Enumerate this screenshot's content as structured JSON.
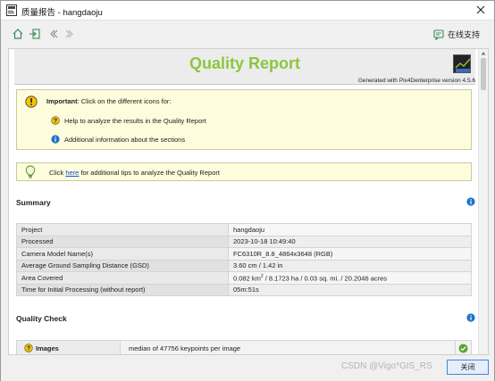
{
  "window": {
    "title": "质量报告 - hangdaoju"
  },
  "toolbar": {
    "support_label": "在线支持"
  },
  "report": {
    "title": "Quality Report",
    "generated_by": "Generated with Pix4Denterprise version 4.5.6",
    "logo_text": "Pix4D"
  },
  "important_box": {
    "important_label": "Important",
    "important_text": ": Click on the different icons for:",
    "help_text": "Help to analyze the results in the Quality Report",
    "info_text": "Additional information about the sections"
  },
  "tips_box": {
    "prefix": "Click ",
    "link_text": "here",
    "suffix": " for additional tips to analyze the Quality Report"
  },
  "summary": {
    "title": "Summary",
    "rows": [
      {
        "label": "Project",
        "value": "hangdaoju"
      },
      {
        "label": "Processed",
        "value": "2023-10-18 10:49:40"
      },
      {
        "label": "Camera Model Name(s)",
        "value": "FC6310R_8.8_4864x3648 (RGB)"
      },
      {
        "label": "Average Ground Sampling Distance (GSD)",
        "value": "3.60 cm / 1.42 in"
      },
      {
        "label": "Area Covered",
        "value_prefix": "0.082 km",
        "value_sup": "2",
        "value_suffix": " / 8.1723 ha / 0.03 sq. mi. / 20.2046 acres"
      },
      {
        "label": "Time for Initial Processing (without report)",
        "value": "05m:51s"
      }
    ]
  },
  "quality_check": {
    "title": "Quality Check",
    "rows": [
      {
        "label": "Images",
        "value": "median of 47756 keypoints per image",
        "status": "ok"
      }
    ]
  },
  "footer": {
    "watermark": "CSDN @Vigo*GIS_RS",
    "close_label": "关闭"
  },
  "colors": {
    "title_green": "#8dc63f",
    "info_blue": "#1d74c9",
    "warn_yellow": "#f5c400",
    "ok_green": "#5aa431"
  }
}
